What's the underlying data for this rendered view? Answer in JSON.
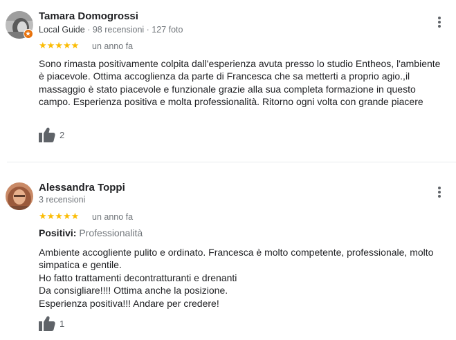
{
  "reviews": [
    {
      "author": "Tamara Domogrossi",
      "local_guide": "Local Guide",
      "stats": " · 98 recensioni · 127 foto",
      "stars": "★★★★★",
      "rating": 5,
      "date": "un anno fa",
      "text": "Sono rimasta positivamente colpita dall'esperienza avuta presso lo studio Entheos, l'ambiente è piacevole. Ottima accoglienza da parte di Francesca che sa metterti a proprio agio.,il massaggio è stato piacevole e funzionale grazie alla sua completa formazione in questo campo. Esperienza positiva e molta professionalità. Ritorno ogni volta con grande piacere",
      "likes": "2",
      "icons": {
        "like": "thumbs-up-icon",
        "menu": "more-vert-icon",
        "badge": "local-guide-badge-icon"
      }
    },
    {
      "author": "Alessandra Toppi",
      "stats": "3 recensioni",
      "stars": "★★★★★",
      "rating": 5,
      "date": "un anno fa",
      "positives_label": "Positivi:",
      "positives_value": " Professionalità",
      "text_lines": [
        "Ambiente accogliente pulito e ordinato. Francesca è molto competente, professionale, molto simpatica e gentile.",
        "Ho fatto trattamenti decontratturanti e drenanti",
        "Da consigliare!!!! Ottima anche la posizione.",
        "Esperienza positiva!!! Andare per credere!"
      ],
      "likes": "1",
      "icons": {
        "like": "thumbs-up-icon",
        "menu": "more-vert-icon"
      }
    }
  ],
  "colors": {
    "star": "#fbbc04",
    "badge": "#e8710a",
    "muted": "#70757a",
    "text": "#202124"
  }
}
